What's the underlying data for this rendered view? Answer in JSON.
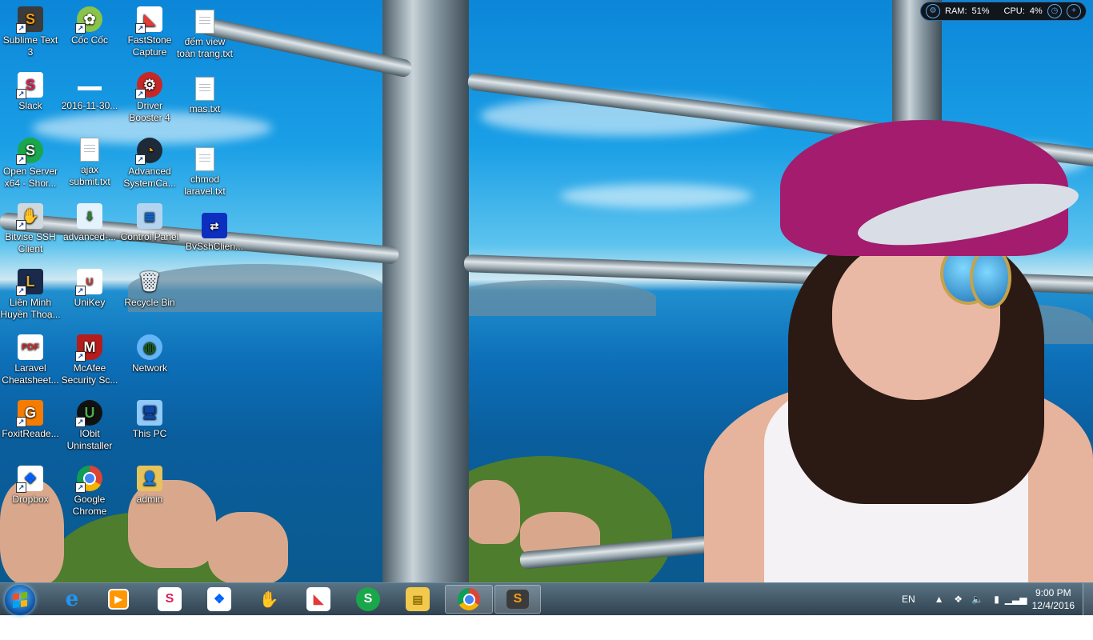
{
  "desktop": {
    "icons": [
      {
        "label": "Sublime Text 3",
        "icon": "sublime-text-icon"
      },
      {
        "label": "Cốc Cốc",
        "icon": "coccoc-browser-icon"
      },
      {
        "label": "FastStone Capture",
        "icon": "faststone-capture-icon"
      },
      {
        "label": "đếm view toàn trang.txt",
        "icon": "text-file-icon"
      },
      {
        "label": "Slack",
        "icon": "slack-icon"
      },
      {
        "label": "2016-11-30...",
        "icon": "generic-file-icon"
      },
      {
        "label": "Driver Booster 4",
        "icon": "driver-booster-icon"
      },
      {
        "label": "mas.txt",
        "icon": "text-file-icon"
      },
      {
        "label": "Open Server x64 - Shor...",
        "icon": "open-server-icon"
      },
      {
        "label": "ajax submit.txt",
        "icon": "text-file-icon"
      },
      {
        "label": "Advanced SystemCa...",
        "icon": "advanced-systemcare-icon"
      },
      {
        "label": "chmod laravel.txt",
        "icon": "text-file-icon"
      },
      {
        "label": "Bitvise SSH Client",
        "icon": "bitvise-ssh-icon"
      },
      {
        "label": "advanced-...",
        "icon": "iobit-installer-icon"
      },
      {
        "label": "Control Panel",
        "icon": "control-panel-icon"
      },
      {
        "label": "BvSshClien...",
        "icon": "bvssh-client-icon"
      },
      {
        "label": "Liên Minh Huyền Thoạ...",
        "icon": "league-of-legends-icon"
      },
      {
        "label": "UniKey",
        "icon": "unikey-icon"
      },
      {
        "label": "Recycle Bin",
        "icon": "recycle-bin-icon"
      },
      {
        "label": "Laravel Cheatsheet...",
        "icon": "pdf-file-icon"
      },
      {
        "label": "McAfee Security Sc...",
        "icon": "mcafee-icon"
      },
      {
        "label": "Network",
        "icon": "network-icon"
      },
      {
        "label": "FoxitReade...",
        "icon": "foxit-reader-icon"
      },
      {
        "label": "IObit Uninstaller",
        "icon": "iobit-uninstaller-icon"
      },
      {
        "label": "This PC",
        "icon": "this-pc-icon"
      },
      {
        "label": "Dropbox",
        "icon": "dropbox-icon"
      },
      {
        "label": "Google Chrome",
        "icon": "chrome-icon"
      },
      {
        "label": "admin",
        "icon": "user-folder-icon"
      }
    ]
  },
  "widget": {
    "ram_label": "RAM:",
    "ram_value": "51%",
    "cpu_label": "CPU:",
    "cpu_value": "4%"
  },
  "taskbar": {
    "pinned": [
      {
        "name": "internet-explorer",
        "icon": "internet-explorer-icon"
      },
      {
        "name": "media-player",
        "icon": "media-player-icon"
      },
      {
        "name": "slack",
        "icon": "slack-icon"
      },
      {
        "name": "dropbox",
        "icon": "dropbox-icon"
      },
      {
        "name": "bitvise",
        "icon": "bitvise-ssh-icon"
      },
      {
        "name": "faststone",
        "icon": "faststone-capture-icon"
      },
      {
        "name": "open-server",
        "icon": "open-server-icon"
      },
      {
        "name": "file-explorer",
        "icon": "folder-icon"
      },
      {
        "name": "chrome",
        "icon": "chrome-icon"
      },
      {
        "name": "sublime-text",
        "icon": "sublime-text-icon"
      }
    ],
    "tray": {
      "language": "EN",
      "time": "9:00 PM",
      "date": "12/4/2016"
    }
  },
  "colors": {
    "taskbar": "#1c3444",
    "accent": "#5fa8e8"
  }
}
